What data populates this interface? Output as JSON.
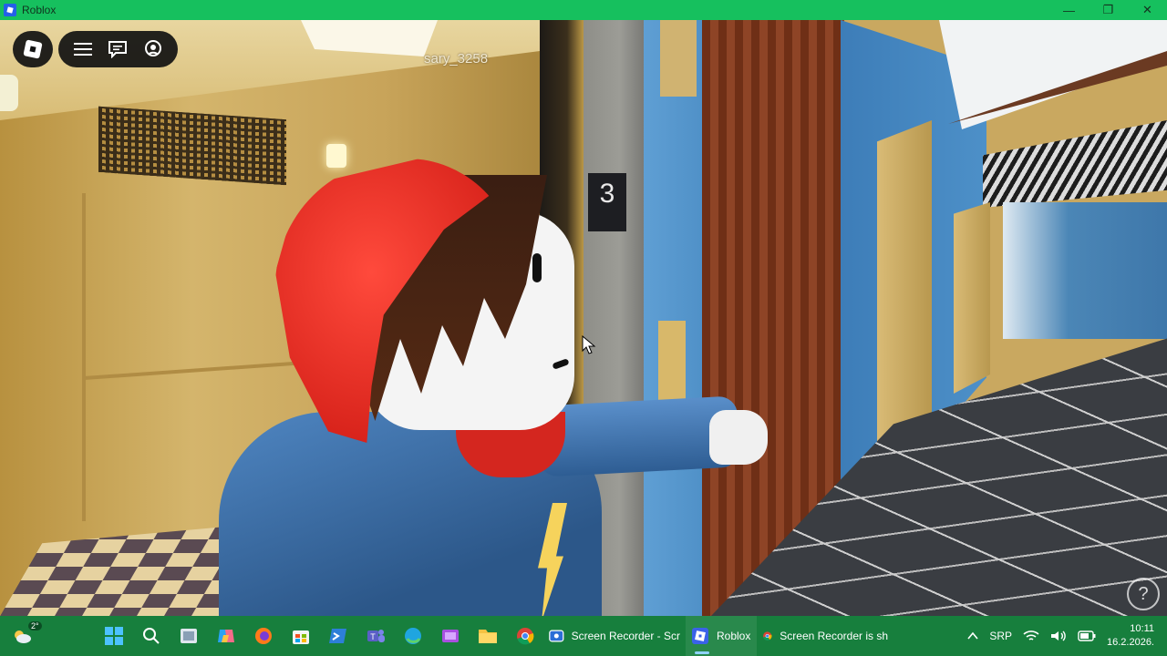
{
  "window": {
    "title": "Roblox",
    "controls": [
      "—",
      "❐",
      "✕"
    ]
  },
  "game": {
    "player_name": "sary_3258",
    "floor_indicator": "3"
  },
  "hud": {
    "logo": "roblox-logo-icon",
    "buttons": [
      "menu-icon",
      "chat-icon",
      "voice-icon"
    ],
    "help": "?"
  },
  "taskbar": {
    "weather_temp": "2°",
    "pinned": [
      "windows-start-icon",
      "search-icon",
      "task-view-icon",
      "copilot-icon",
      "firefox-icon",
      "store-icon",
      "powershell-icon",
      "teams-icon",
      "edge-icon",
      "video-editor-icon",
      "file-explorer-icon",
      "chrome-icon"
    ],
    "apps": [
      {
        "label": "Screen Recorder - Scr",
        "icon": "screen-recorder-icon"
      },
      {
        "label": "Roblox",
        "icon": "roblox-icon"
      },
      {
        "label": "Screen Recorder is sh",
        "icon": "chrome-icon"
      }
    ],
    "language": "SRP",
    "time": "10:11",
    "date": "16.2.2026."
  }
}
